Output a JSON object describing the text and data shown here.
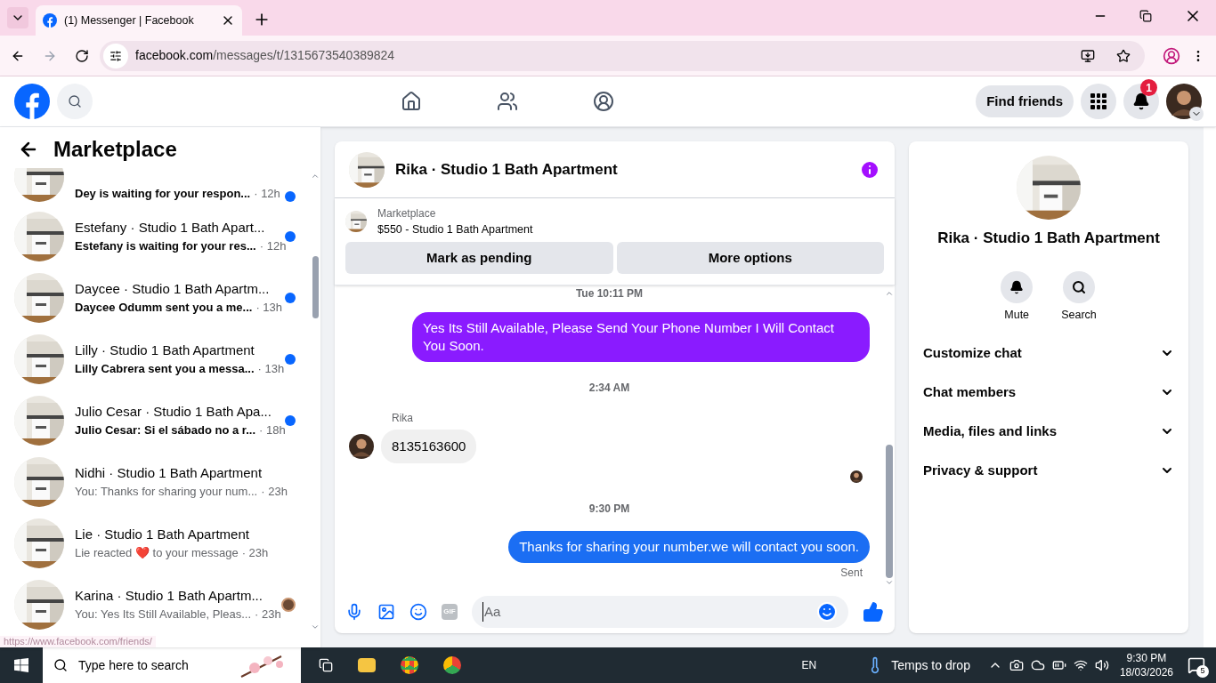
{
  "browser": {
    "tab_title": "(1) Messenger | Facebook",
    "url_host": "facebook.com",
    "url_path": "/messages/t/1315673540389824"
  },
  "header": {
    "find_friends": "Find friends",
    "notification_count": "1"
  },
  "sidebar": {
    "title": "Marketplace",
    "conversations": [
      {
        "preview": "Dey is waiting for your respon...",
        "time": "· 12h",
        "unread": true,
        "seen_avatar": false
      },
      {
        "title": "Estefany · Studio 1 Bath Apart...",
        "preview": "Estefany is waiting for your res...",
        "time": "· 12h",
        "unread": true,
        "seen_avatar": false
      },
      {
        "title": "Daycee · Studio 1 Bath Apartm...",
        "preview": "Daycee Odumm sent you a me...",
        "time": "· 13h",
        "unread": true,
        "seen_avatar": false
      },
      {
        "title": "Lilly · Studio 1 Bath Apartment",
        "preview": "Lilly Cabrera sent you a messa...",
        "time": "· 13h",
        "unread": true,
        "seen_avatar": false
      },
      {
        "title": "Julio Cesar · Studio 1 Bath Apa...",
        "preview": "Julio Cesar: Si el sábado no a r...",
        "time": "· 18h",
        "unread": true,
        "seen_avatar": false
      },
      {
        "title": "Nidhi · Studio 1 Bath Apartment",
        "preview": "You: Thanks for sharing your num...",
        "time": "· 23h",
        "unread": false,
        "seen_avatar": false
      },
      {
        "title": "Lie · Studio 1 Bath Apartment",
        "preview": "Lie reacted ❤️ to your message",
        "time": "· 23h",
        "unread": false,
        "seen_avatar": false
      },
      {
        "title": "Karina · Studio 1 Bath Apartm...",
        "preview": "You: Yes Its Still Available, Pleas...",
        "time": "· 23h",
        "unread": false,
        "seen_avatar": true
      }
    ]
  },
  "status_url": "https://www.facebook.com/friends/",
  "chat": {
    "title": "Rika · Studio 1 Bath Apartment",
    "listing_label": "Marketplace",
    "listing_title": "$550 - Studio 1 Bath Apartment",
    "buttons": [
      "Mark as pending",
      "More options"
    ],
    "messages": [
      {
        "kind": "timestamp",
        "text": "Tue 10:11 PM"
      },
      {
        "kind": "outgoing",
        "text": "Yes Its Still Available, Please Send Your Phone Number I Will Contact You Soon.",
        "color": "#8a1bff"
      },
      {
        "kind": "timestamp",
        "text": "2:34 AM"
      },
      {
        "kind": "incoming",
        "sender": "Rika",
        "text": "8135163600"
      },
      {
        "kind": "seen"
      },
      {
        "kind": "timestamp",
        "text": "9:30 PM"
      },
      {
        "kind": "outgoing",
        "text": "Thanks for sharing your number.we will contact you soon.",
        "color": "#1b6ef3"
      },
      {
        "kind": "status",
        "text": "Sent"
      }
    ],
    "gif_label": "GIF",
    "composer_placeholder": "Aa"
  },
  "details": {
    "name": "Rika · Studio 1 Bath Apartment",
    "actions": [
      "Mute",
      "Search"
    ],
    "sections": [
      {
        "label": "Customize chat",
        "expanded": false
      },
      {
        "label": "Chat members",
        "expanded": false
      },
      {
        "label": "Media, files and links",
        "expanded": false
      },
      {
        "label": "Privacy & support",
        "expanded": false
      }
    ]
  },
  "taskbar": {
    "search_placeholder": "Type here to search",
    "language": "EN",
    "weather": "Temps to drop",
    "time": "9:30 PM",
    "date": "18/03/2026",
    "notifications": "5"
  }
}
